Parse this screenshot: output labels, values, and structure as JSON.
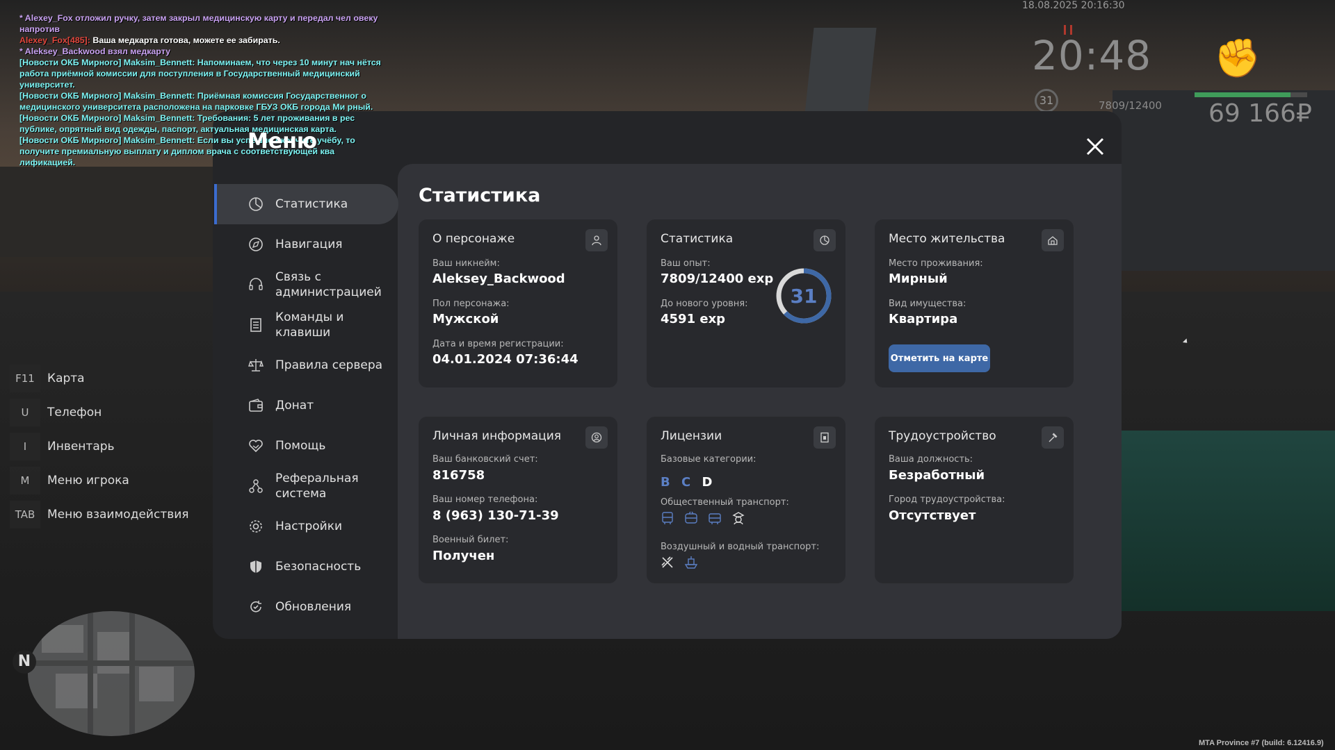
{
  "chat": [
    {
      "color": "purple",
      "text": "* Alexey_Fox отложил ручку, затем закрыл медицинскую карту и передал чел овеку напротив"
    },
    {
      "color": "mixed",
      "prefix": "Alexey_Fox[485]:",
      "text": " Ваша медкарта готова, можете ее забирать."
    },
    {
      "color": "purple",
      "text": "* Aleksey_Backwood взял медкарту"
    },
    {
      "color": "cyan",
      "text": "[Новости ОКБ Мирного] Maksim_Bennett: Напоминаем, что через 10 минут нач нётся работа приёмной комиссии для поступления в Государственный медицинский университет."
    },
    {
      "color": "cyan",
      "text": "[Новости ОКБ Мирного] Maksim_Bennett: Приёмная комиссия Государственног о медицинского университета расположена на парковке ГБУЗ ОКБ города Ми рный."
    },
    {
      "color": "cyan",
      "text": "[Новости ОКБ Мирного] Maksim_Bennett: Требования: 5 лет проживания в рес публике, опрятный вид одежды, паспорт, актуальная медицинская карта."
    },
    {
      "color": "cyan",
      "text": "[Новости ОКБ Мирного] Maksim_Bennett: Если вы успешно окончите учёбу, то получите премиальную выплату и диплом врача с соответствующей ква лификацией."
    }
  ],
  "hud": {
    "datetime": "18.08.2025 20:16:30",
    "time": "20:48",
    "level": "31",
    "exp": "7809/12400",
    "health_fraction": 0.85,
    "money": "69 166₽",
    "build": "MTA Province #7 (build: 6.12416.9)",
    "compass": "N"
  },
  "keys": [
    {
      "key": "F11",
      "label": "Карта"
    },
    {
      "key": "U",
      "label": "Телефон"
    },
    {
      "key": "I",
      "label": "Инвентарь"
    },
    {
      "key": "M",
      "label": "Меню игрока"
    },
    {
      "key": "TAB",
      "label": "Меню взаимодействия"
    }
  ],
  "menu": {
    "title": "Меню",
    "items": [
      {
        "label": "Статистика",
        "icon": "pie-chart-icon"
      },
      {
        "label": "Навигация",
        "icon": "compass-icon"
      },
      {
        "label": "Связь с администрацией",
        "icon": "headset-icon"
      },
      {
        "label": "Команды и клавиши",
        "icon": "document-icon"
      },
      {
        "label": "Правила сервера",
        "icon": "scales-icon"
      },
      {
        "label": "Донат",
        "icon": "wallet-icon"
      },
      {
        "label": "Помощь",
        "icon": "handshake-icon"
      },
      {
        "label": "Реферальная система",
        "icon": "referral-icon"
      },
      {
        "label": "Настройки",
        "icon": "gear-icon"
      },
      {
        "label": "Безопасность",
        "icon": "shield-icon"
      },
      {
        "label": "Обновления",
        "icon": "refresh-icon"
      }
    ]
  },
  "content": {
    "title": "Статистика",
    "character": {
      "header": "О персонаже",
      "nickname_label": "Ваш никнейм:",
      "nickname": "Aleksey_Backwood",
      "gender_label": "Пол персонажа:",
      "gender": "Мужской",
      "reg_label": "Дата и время регистрации:",
      "reg": "04.01.2024 07:36:44"
    },
    "stats": {
      "header": "Статистика",
      "exp_label": "Ваш опыт:",
      "exp": "7809/12400 exp",
      "next_label": "До нового уровня:",
      "next": "4591 exp",
      "level": "31",
      "progress": 0.63
    },
    "residence": {
      "header": "Место жительства",
      "place_label": "Место проживания:",
      "place": "Мирный",
      "type_label": "Вид имущества:",
      "type": "Квартира",
      "button": "Отметить на карте"
    },
    "personal": {
      "header": "Личная информация",
      "bank_label": "Ваш банковский счет:",
      "bank": "816758",
      "phone_label": "Ваш номер телефона:",
      "phone": "8 (963) 130-71-39",
      "military_label": "Военный билет:",
      "military": "Получен"
    },
    "licenses": {
      "header": "Лицензии",
      "base_label": "Базовые категории:",
      "categories": [
        "B",
        "C",
        "D"
      ],
      "public_label": "Общественный транспорт:",
      "air_label": "Воздушный и водный транспорт:"
    },
    "employment": {
      "header": "Трудоустройство",
      "position_label": "Ваша должность:",
      "position": "Безработный",
      "city_label": "Город трудоустройства:",
      "city": "Отсутствует"
    }
  },
  "colors": {
    "accent": "#3e68a6",
    "license_active": "#5b7fc4",
    "panel": "#242528",
    "content": "#323338",
    "card": "#28292d"
  }
}
